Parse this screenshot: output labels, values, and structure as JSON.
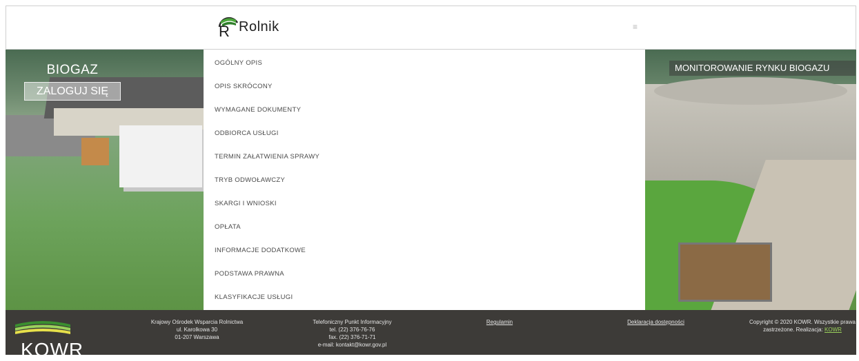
{
  "header": {
    "logo_text": "Rolnik",
    "menu_icon": "hamburger-icon"
  },
  "hero": {
    "left_title": "BIOGAZ",
    "login_label": "ZALOGUJ SIĘ",
    "right_label": "MONITOROWANIE RYNKU BIOGAZU"
  },
  "menu": {
    "items": [
      "OGÓLNY OPIS",
      "OPIS SKRÓCONY",
      "WYMAGANE DOKUMENTY",
      "ODBIORCA USŁUGI",
      "TERMIN ZAŁATWIENIA SPRAWY",
      "TRYB ODWOŁAWCZY",
      "SKARGI I WNIOSKI",
      "OPŁATA",
      "INFORMACJE DODATKOWE",
      "PODSTAWA PRAWNA",
      "KLASYFIKACJE USŁUGI"
    ]
  },
  "footer": {
    "logo_text": "KOWR",
    "org": {
      "line1": "Krajowy Ośrodek Wsparcia Rolnictwa",
      "line2": "ul. Karolkowa 30",
      "line3": "01-207 Warszawa"
    },
    "contact": {
      "line1": "Telefoniczny Punkt Informacyjny",
      "line2": "tel. (22) 376-76-76",
      "line3": "fax. (22) 376-71-71",
      "line4": "e-mail: kontakt@kowr.gov.pl"
    },
    "regulamin": "Regulamin",
    "accessibility": "Deklaracja dostępności",
    "copyright_line1": "Copyright © 2020 KOWR. Wszystkie prawa",
    "copyright_line2": "zastrzeżone. Realizacja:",
    "realizacja_link": "KOWR"
  },
  "colors": {
    "footer_bg": "#3d3b38",
    "link_accent": "#9bd25c",
    "logo_green": "#3a8f2f"
  }
}
